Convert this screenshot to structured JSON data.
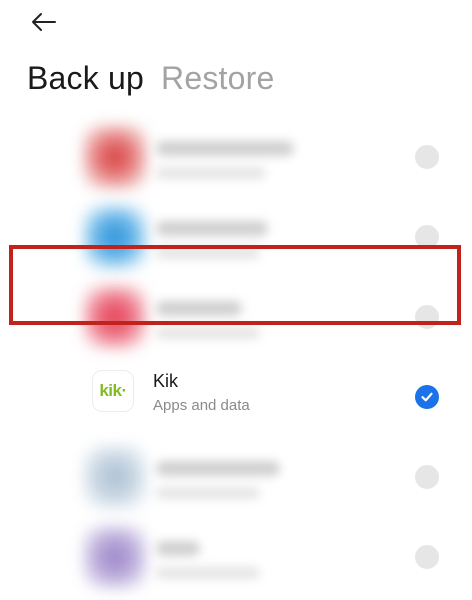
{
  "header": {
    "back_label": "Back",
    "tabs": [
      {
        "label": "Back up",
        "active": true
      },
      {
        "label": "Restore",
        "active": false
      }
    ]
  },
  "highlighted_app": {
    "name": "Kik",
    "subtitle": "Apps and data",
    "logo_text": "kik·",
    "selected": true
  },
  "colors": {
    "accent": "#1a73e8",
    "highlight_border": "#c0221c",
    "kik_green": "#82bc23"
  }
}
